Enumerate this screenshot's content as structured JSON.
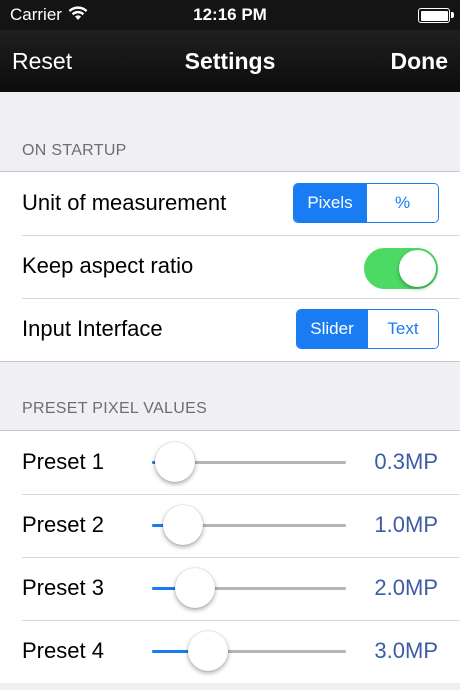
{
  "status_bar": {
    "carrier": "Carrier",
    "wifi_icon": "wifi-icon",
    "time": "12:16 PM",
    "battery_icon": "battery-icon",
    "battery_level": 1.0
  },
  "nav": {
    "left_button": "Reset",
    "title": "Settings",
    "right_button": "Done"
  },
  "sections": {
    "startup": {
      "header": "ON STARTUP",
      "unit_label": "Unit of measurement",
      "unit_options": [
        "Pixels",
        "%"
      ],
      "unit_selected": "Pixels",
      "aspect_label": "Keep aspect ratio",
      "aspect_on": true,
      "interface_label": "Input Interface",
      "interface_options": [
        "Slider",
        "Text"
      ],
      "interface_selected": "Slider"
    },
    "presets": {
      "header": "PRESET PIXEL VALUES",
      "items": [
        {
          "label": "Preset 1",
          "value": "0.3MP",
          "level": 0.12
        },
        {
          "label": "Preset 2",
          "value": "1.0MP",
          "level": 0.16
        },
        {
          "label": "Preset 3",
          "value": "2.0MP",
          "level": 0.22
        },
        {
          "label": "Preset 4",
          "value": "3.0MP",
          "level": 0.29
        }
      ]
    }
  },
  "colors": {
    "accent": "#1a7cf2",
    "toggle_on": "#4cd964",
    "value_text": "#3d5ca5"
  }
}
